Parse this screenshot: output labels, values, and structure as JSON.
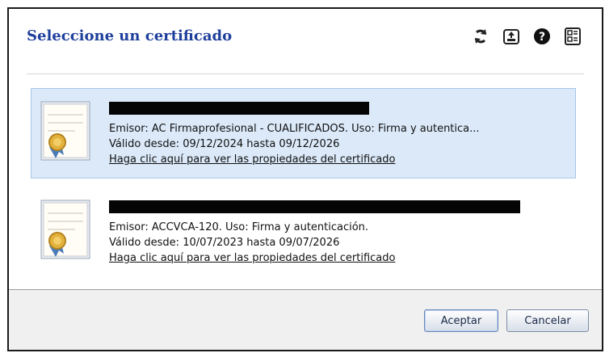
{
  "dialog": {
    "title": "Seleccione un certificado",
    "toolbar": [
      {
        "icon": "refresh-icon"
      },
      {
        "icon": "import-icon"
      },
      {
        "icon": "help-icon"
      },
      {
        "icon": "details-icon"
      }
    ]
  },
  "certificates": [
    {
      "selected": true,
      "subject_redacted": true,
      "issuer_line": "Emisor: AC Firmaprofesional - CUALIFICADOS. Uso: Firma y autentica...",
      "validity_line": "Válido desde: 09/12/2024 hasta 09/12/2026",
      "link_text": "Haga clic aquí para ver las propiedades del certificado"
    },
    {
      "selected": false,
      "subject_redacted": true,
      "issuer_line": "Emisor: ACCVCA-120. Uso: Firma y autenticación.",
      "validity_line": "Válido desde: 10/07/2023 hasta 09/07/2026",
      "link_text": "Haga clic aquí para ver las propiedades del certificado"
    }
  ],
  "buttons": {
    "accept": "Aceptar",
    "cancel": "Cancelar"
  },
  "colors": {
    "title": "#1f3f9c",
    "selected_bg": "#dbe9f9",
    "selected_border": "#a9c7ea",
    "footer_bg": "#f0f0f0"
  }
}
